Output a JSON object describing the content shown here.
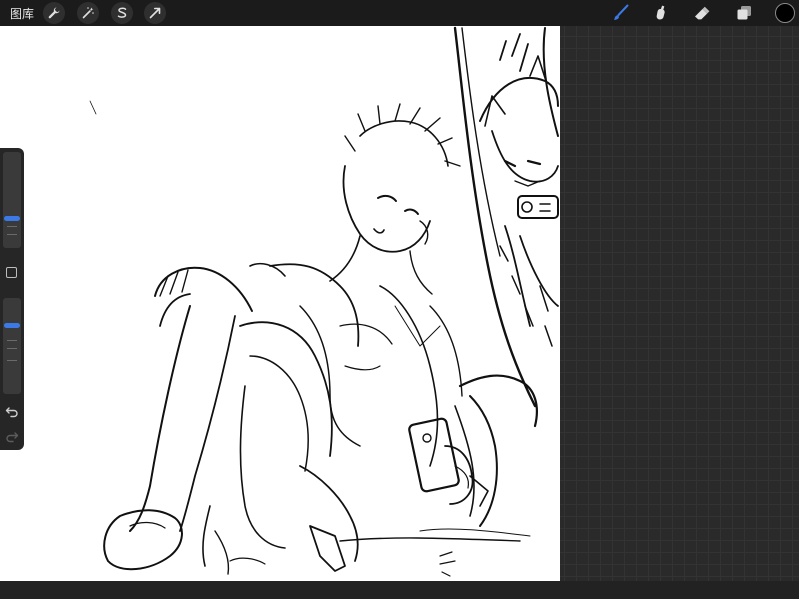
{
  "topbar": {
    "gallery_label": "图库",
    "left_tools": [
      "wrench-icon",
      "magic-wand-icon",
      "selection-icon",
      "transform-arrow-icon"
    ],
    "right_tools": [
      "brush-icon",
      "smudge-icon",
      "eraser-icon",
      "layers-icon"
    ],
    "active_tool": "brush-icon",
    "current_color": "#000000"
  },
  "sidebar": {
    "controls": [
      "brush-size-slider",
      "modify-button",
      "opacity-slider",
      "undo-button",
      "redo-button"
    ],
    "brush_size_level": 0.32,
    "opacity_level": 0.78
  },
  "canvas": {
    "content": "line-art-sketch"
  },
  "colors": {
    "accent": "#3b7ae6",
    "toolbar": "#1b1b1b",
    "workspace": "#2a2a2a"
  }
}
